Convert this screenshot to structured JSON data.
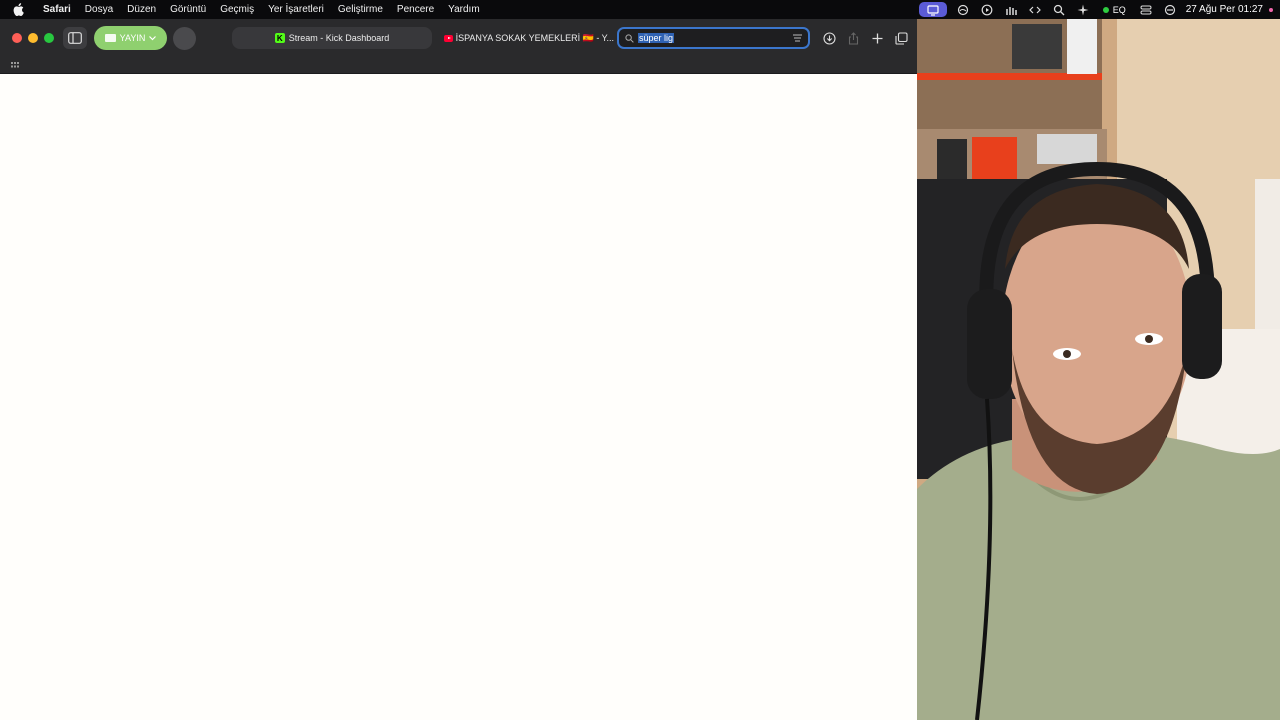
{
  "menubar": {
    "app_name": "Safari",
    "menus": [
      "Dosya",
      "Düzen",
      "Görüntü",
      "Geçmiş",
      "Yer İşaretleri",
      "Geliştirme",
      "Pencere",
      "Yardım"
    ],
    "status": {
      "eq_label": "EQ",
      "clock": "27 Ağu Per  01:27"
    },
    "icons": [
      "apple-logo-icon",
      "screen-share-icon",
      "cloud-icon",
      "play-circle-icon",
      "radio-tower-icon",
      "code-brackets-icon",
      "search-icon",
      "sparkle-icon",
      "control-center-icon",
      "do-not-disturb-icon"
    ]
  },
  "safari": {
    "profile_label": "YAYIN",
    "tabs": [
      {
        "title": "Stream - Kick Dashboard",
        "favicon": "kick-icon",
        "favicon_letter": "K"
      },
      {
        "title": "İSPANYA SOKAK YEMEKLERİ 🇪🇸 - Y...",
        "favicon": "youtube-icon"
      }
    ],
    "address_bar": {
      "value": "süper lig"
    },
    "toolbar_icons": [
      "downloads-icon",
      "share-icon",
      "new-tab-icon",
      "tab-overview-icon"
    ]
  },
  "colors": {
    "menubar_bg": "#0a0a0c",
    "toolbar_bg": "#2a2a2c",
    "profile_green": "#8fd06f",
    "address_focus": "#3b76cc",
    "page_bg": "#fffefb"
  }
}
